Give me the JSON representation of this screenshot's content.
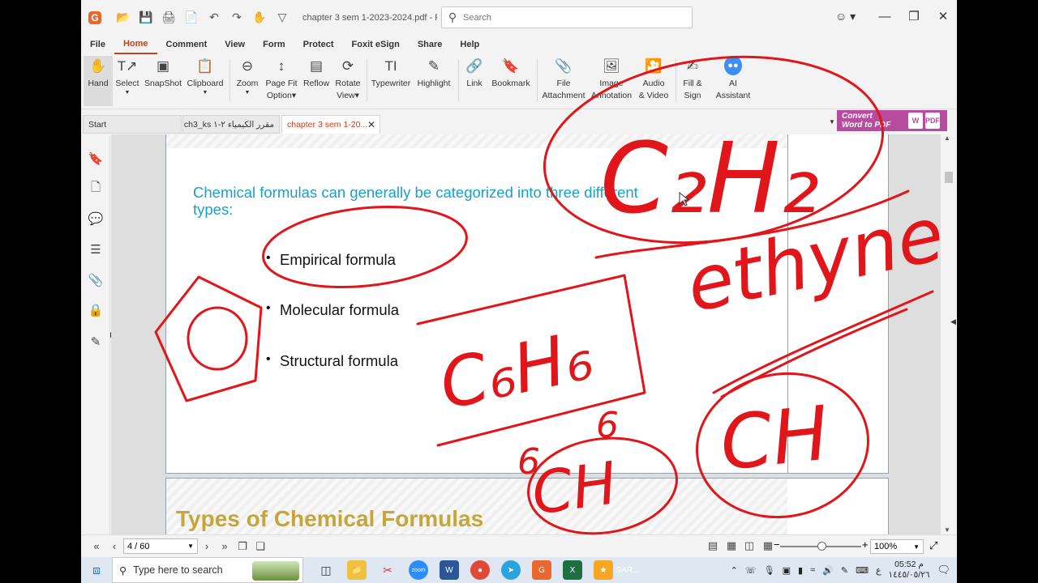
{
  "window": {
    "doc_title": "chapter 3 sem 1-2023-2024.pdf - F...",
    "search_placeholder": "Search"
  },
  "menu": [
    "File",
    "Home",
    "Comment",
    "View",
    "Form",
    "Protect",
    "Foxit eSign",
    "Share",
    "Help"
  ],
  "ribbon": {
    "hand": "Hand",
    "select": "Select",
    "snapshot": "SnapShot",
    "clipboard": "Clipboard",
    "zoom": "Zoom",
    "pagefit_1": "Page Fit",
    "pagefit_2": "Option",
    "reflow": "Reflow",
    "rotate_1": "Rotate",
    "rotate_2": "View",
    "typewriter": "Typewriter",
    "highlight": "Highlight",
    "link": "Link",
    "bookmark": "Bookmark",
    "file_1": "File",
    "file_2": "Attachment",
    "image_1": "Image",
    "image_2": "Annotation",
    "audio_1": "Audio",
    "audio_2": "& Video",
    "fill_1": "Fill &",
    "fill_2": "Sign",
    "ai_1": "AI",
    "ai_2": "Assistant"
  },
  "tabs": {
    "start": "Start",
    "tab2": "مقرر الكيمياء ٢-١ ch3_ks...",
    "tab3": "chapter 3 sem 1-20..."
  },
  "convert": {
    "line1": "Convert",
    "line2": "Word to PDF"
  },
  "document": {
    "intro": "Chemical formulas can generally be categorized into three different types:",
    "bullets": [
      "Empirical formula",
      "Molecular formula",
      "Structural formula"
    ],
    "next_title": "Types of Chemical Formulas"
  },
  "annotations": {
    "c2h2": "C₂H₂",
    "ethyne": "ethyne",
    "c6h6": "C₆H₆",
    "ch_sub": "CH",
    "ch": "CH",
    "six_a": "6",
    "six_b": "6"
  },
  "status": {
    "page": "4 / 60",
    "zoom": "100%"
  },
  "taskbar": {
    "search": "Type here to search",
    "app_label": "SAR...",
    "time": "05:52 م",
    "date": "١٤٤٥/٠٥/٢٦",
    "lang": "ع"
  },
  "colors": {
    "accent": "#c7421a",
    "ink": "#e0161b",
    "intro_text": "#1aa0c8",
    "title_gold": "#c6a53a"
  }
}
